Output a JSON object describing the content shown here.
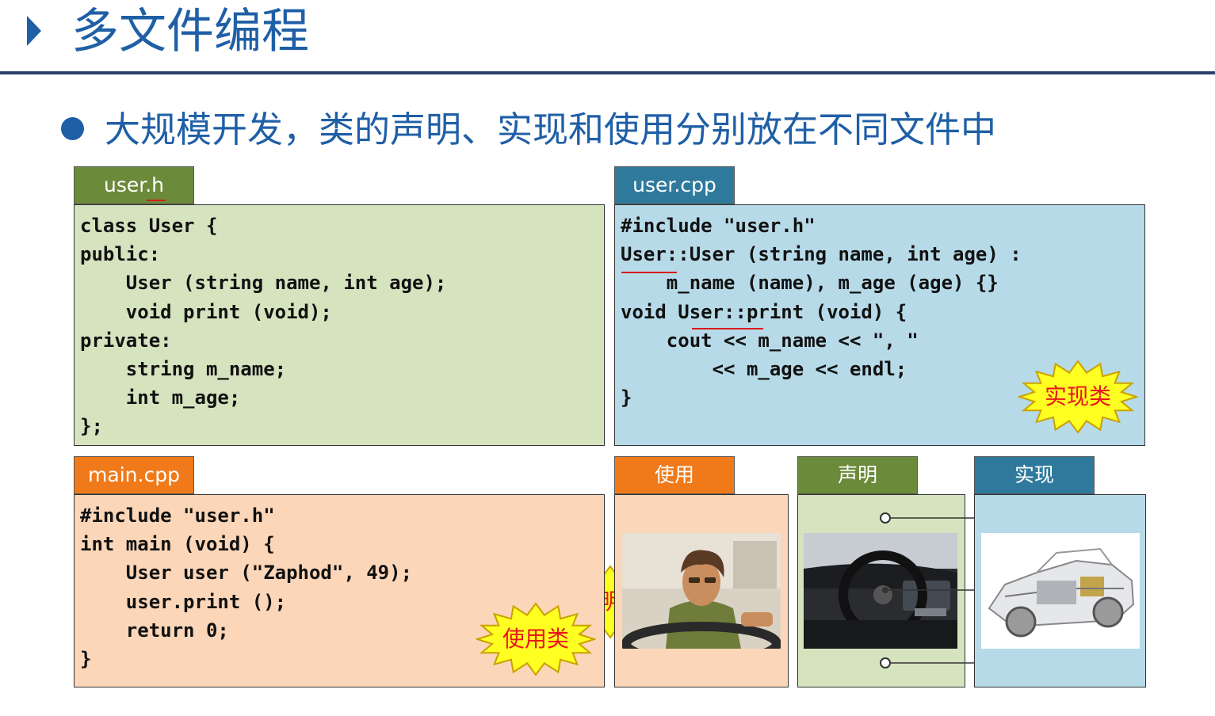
{
  "title": "多文件编程",
  "bullet": "大规模开发，类的声明、实现和使用分别放在不同文件中",
  "user_h": {
    "tab": "user.h",
    "code": "class User {\npublic:\n    User (string name, int age);\n    void print (void);\nprivate:\n    string m_name;\n    int m_age;\n};",
    "badge": "声明类"
  },
  "user_cpp": {
    "tab": "user.cpp",
    "code": "#include \"user.h\"\nUser::User (string name, int age) :\n    m_name (name), m_age (age) {}\nvoid User::print (void) {\n    cout << m_name << \", \"\n        << m_age << endl;\n}",
    "badge": "实现类"
  },
  "main_cpp": {
    "tab": "main.cpp",
    "code": "#include \"user.h\"\nint main (void) {\n    User user (\"Zaphod\", 49);\n    user.print ();\n    return 0;\n}",
    "badge": "使用类"
  },
  "analogy": {
    "use_label": "使用",
    "declare_label": "声明",
    "implement_label": "实现",
    "use_image": "driver-illustration",
    "declare_image": "car-dashboard-photo",
    "implement_image": "car-cutaway-illustration"
  },
  "colors": {
    "accent": "#1f5fa6",
    "green": "#6b8a3a",
    "blue": "#2f7a9c",
    "orange": "#f07a1a",
    "badge_text": "#e8161c",
    "badge_fill": "#ffff22"
  }
}
